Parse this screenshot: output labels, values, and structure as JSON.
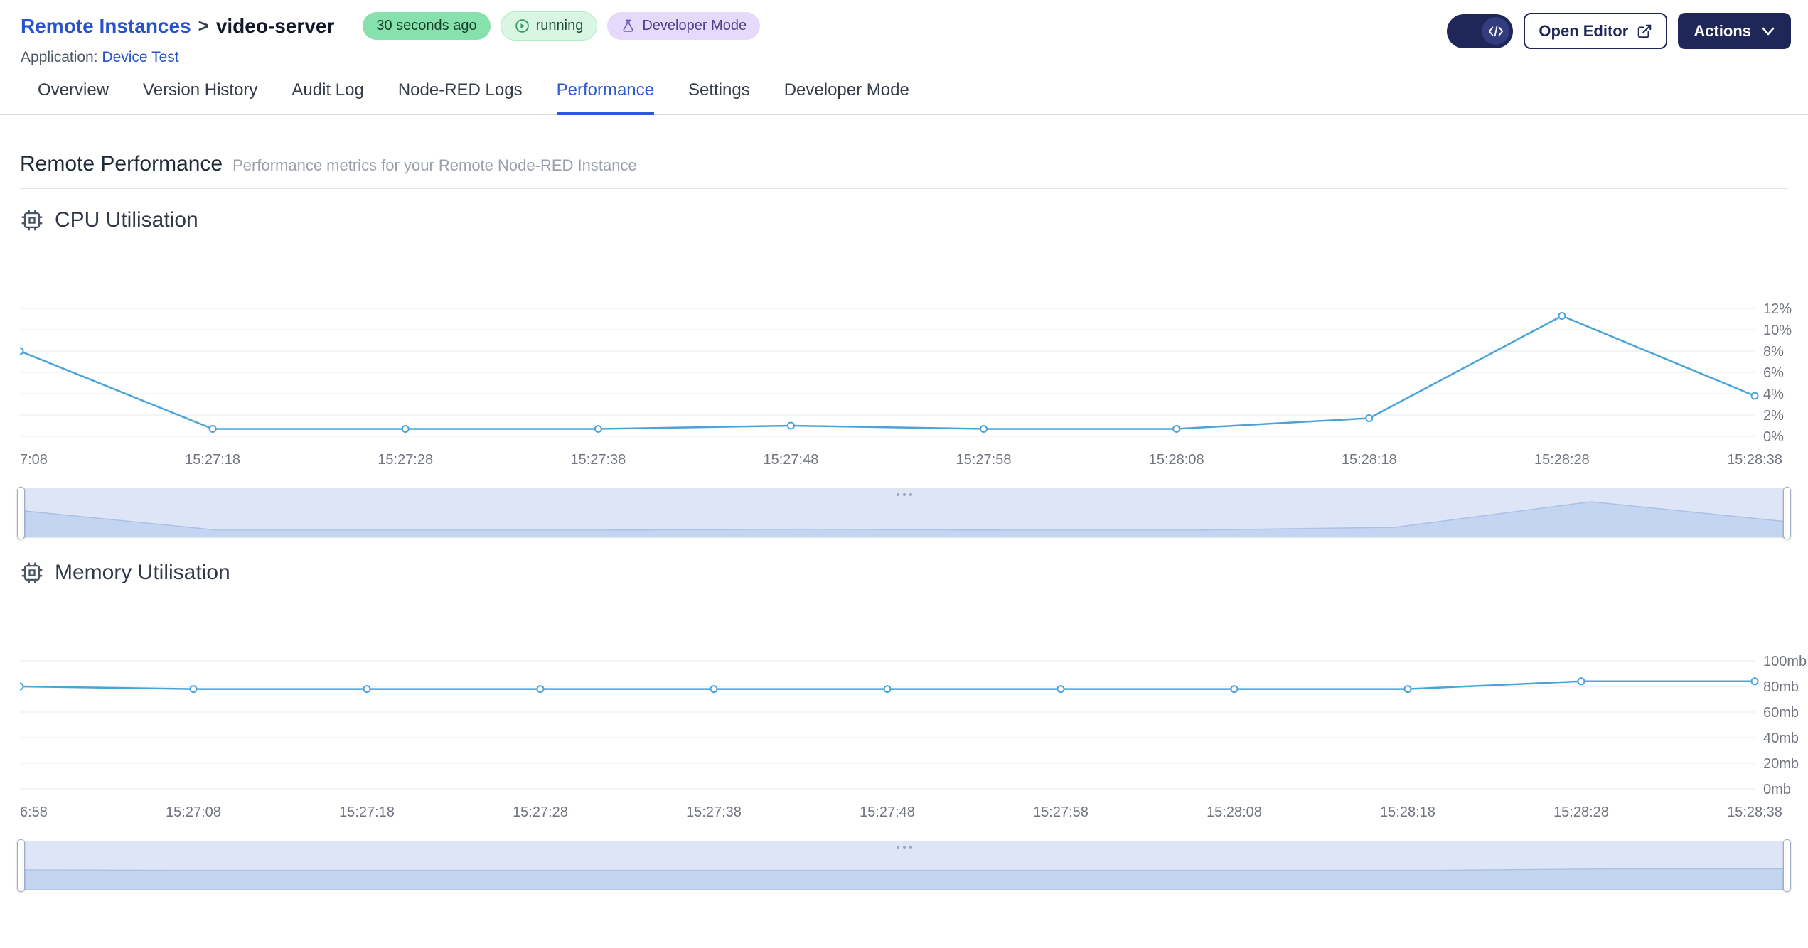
{
  "colors": {
    "link_blue": "#2853cc",
    "navy": "#1f2658",
    "chart_line": "#4aa4da",
    "badge_green": "#87e1ac",
    "badge_green_light": "#d9f6e3",
    "badge_purple": "#e6d9f9"
  },
  "header": {
    "breadcrumb": {
      "root": "Remote Instances",
      "separator": ">",
      "current": "video-server"
    },
    "badges": {
      "last_seen": "30 seconds ago",
      "status": "running",
      "developer_mode": "Developer Mode"
    },
    "application_label": "Application:",
    "application_name": "Device Test",
    "buttons": {
      "open_editor": "Open Editor",
      "actions": "Actions"
    }
  },
  "tabs": [
    {
      "label": "Overview",
      "active": false
    },
    {
      "label": "Version History",
      "active": false
    },
    {
      "label": "Audit Log",
      "active": false
    },
    {
      "label": "Node-RED Logs",
      "active": false
    },
    {
      "label": "Performance",
      "active": true
    },
    {
      "label": "Settings",
      "active": false
    },
    {
      "label": "Developer Mode",
      "active": false
    }
  ],
  "page": {
    "title": "Remote Performance",
    "subtitle": "Performance metrics for your Remote Node-RED Instance"
  },
  "chart_data": [
    {
      "id": "cpu",
      "type": "line",
      "title": "CPU Utilisation",
      "x": [
        "7:08",
        "15:27:18",
        "15:27:28",
        "15:27:38",
        "15:27:48",
        "15:27:58",
        "15:28:08",
        "15:28:18",
        "15:28:28",
        "15:28:38"
      ],
      "values": [
        8,
        0.7,
        0.7,
        0.7,
        1,
        0.7,
        0.7,
        1.7,
        11.3,
        3.8
      ],
      "ylim": [
        0,
        12
      ],
      "ytick_values": [
        0,
        2,
        4,
        6,
        8,
        10,
        12
      ],
      "yticks": [
        "0%",
        "2%",
        "4%",
        "6%",
        "8%",
        "10%",
        "12%"
      ],
      "y_axis_position": "right",
      "grid": true,
      "legend": false,
      "navigator": true,
      "line_color": "#4aa4da"
    },
    {
      "id": "memory",
      "type": "line",
      "title": "Memory Utilisation",
      "x": [
        "6:58",
        "15:27:08",
        "15:27:18",
        "15:27:28",
        "15:27:38",
        "15:27:48",
        "15:27:58",
        "15:28:08",
        "15:28:18",
        "15:28:28",
        "15:28:38"
      ],
      "values": [
        80,
        78,
        78,
        78,
        78,
        78,
        78,
        78,
        78,
        84,
        84
      ],
      "ylim": [
        0,
        100
      ],
      "ytick_values": [
        0,
        20,
        40,
        60,
        80,
        100
      ],
      "yticks": [
        "0mb",
        "20mb",
        "40mb",
        "60mb",
        "80mb",
        "100mb"
      ],
      "y_axis_position": "right",
      "grid": true,
      "legend": false,
      "navigator": true,
      "line_color": "#4aa4da"
    }
  ]
}
